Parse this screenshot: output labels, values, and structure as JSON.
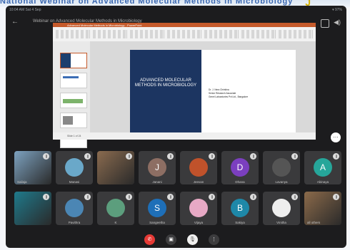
{
  "banner": {
    "text": "National Webinar on Advanced Molecular Methods in Microbiology",
    "logo": "J"
  },
  "status_bar": {
    "left": "10:04 AM  Sat 4 Sep",
    "right": "▾ 97%"
  },
  "meeting": {
    "title": "Webinar on Advanced Molecular Methods in Microbiology",
    "back": "←",
    "speaker": "◀)"
  },
  "presentation": {
    "ribbon_title": "Advanced Molecular Methods in Microbiology - PowerPoint",
    "slide_title": "Advanced Molecular Methods in Microbiology",
    "author_lines": [
      "Dr. J. Nera Christina",
      "Senior Research Associate",
      "Genei Laboratories Pvt Ltd., Bangalore"
    ],
    "status_text": "Slide 1 of 24"
  },
  "more_button": "…",
  "participants_row1": [
    {
      "name": "Sailaja",
      "type": "photo",
      "bg": "#7da2c0"
    },
    {
      "name": "Manasi",
      "type": "avatar-img",
      "bg": "#6aa8c9"
    },
    {
      "name": "",
      "type": "photo",
      "bg": "#8a6b4f"
    },
    {
      "name": "Janani",
      "type": "letter",
      "letter": "J",
      "bg": "#8d6e63"
    },
    {
      "name": "Jeevan",
      "type": "avatar-img",
      "bg": "#c0522b"
    },
    {
      "name": "Dhana",
      "type": "letter",
      "letter": "D",
      "bg": "#7b3fbf"
    },
    {
      "name": "Lavanya",
      "type": "avatar-img",
      "bg": "#555555"
    },
    {
      "name": "Abinaya",
      "type": "letter",
      "letter": "A",
      "bg": "#26a69a"
    }
  ],
  "participants_row2": [
    {
      "name": "",
      "type": "photo",
      "bg": "#1f7a8c"
    },
    {
      "name": "Pavithra",
      "type": "avatar-img",
      "bg": "#4b86b4"
    },
    {
      "name": "K",
      "type": "avatar-img",
      "bg": "#5c9e7d"
    },
    {
      "name": "Sangeetha",
      "type": "letter",
      "letter": "S",
      "bg": "#1e6fb8"
    },
    {
      "name": "Vijaya",
      "type": "avatar-img",
      "bg": "#e7a9c5"
    },
    {
      "name": "Sakiya",
      "type": "letter",
      "letter": "B",
      "bg": "#1e88a8"
    },
    {
      "name": "Vinitha",
      "type": "avatar-img",
      "bg": "#eeeeee"
    },
    {
      "name": "all others",
      "type": "photo",
      "bg": "#8b6a4a"
    }
  ],
  "controls": {
    "hangup": "✆",
    "camera": "▣",
    "mic": "🎙",
    "more": "⋮"
  }
}
